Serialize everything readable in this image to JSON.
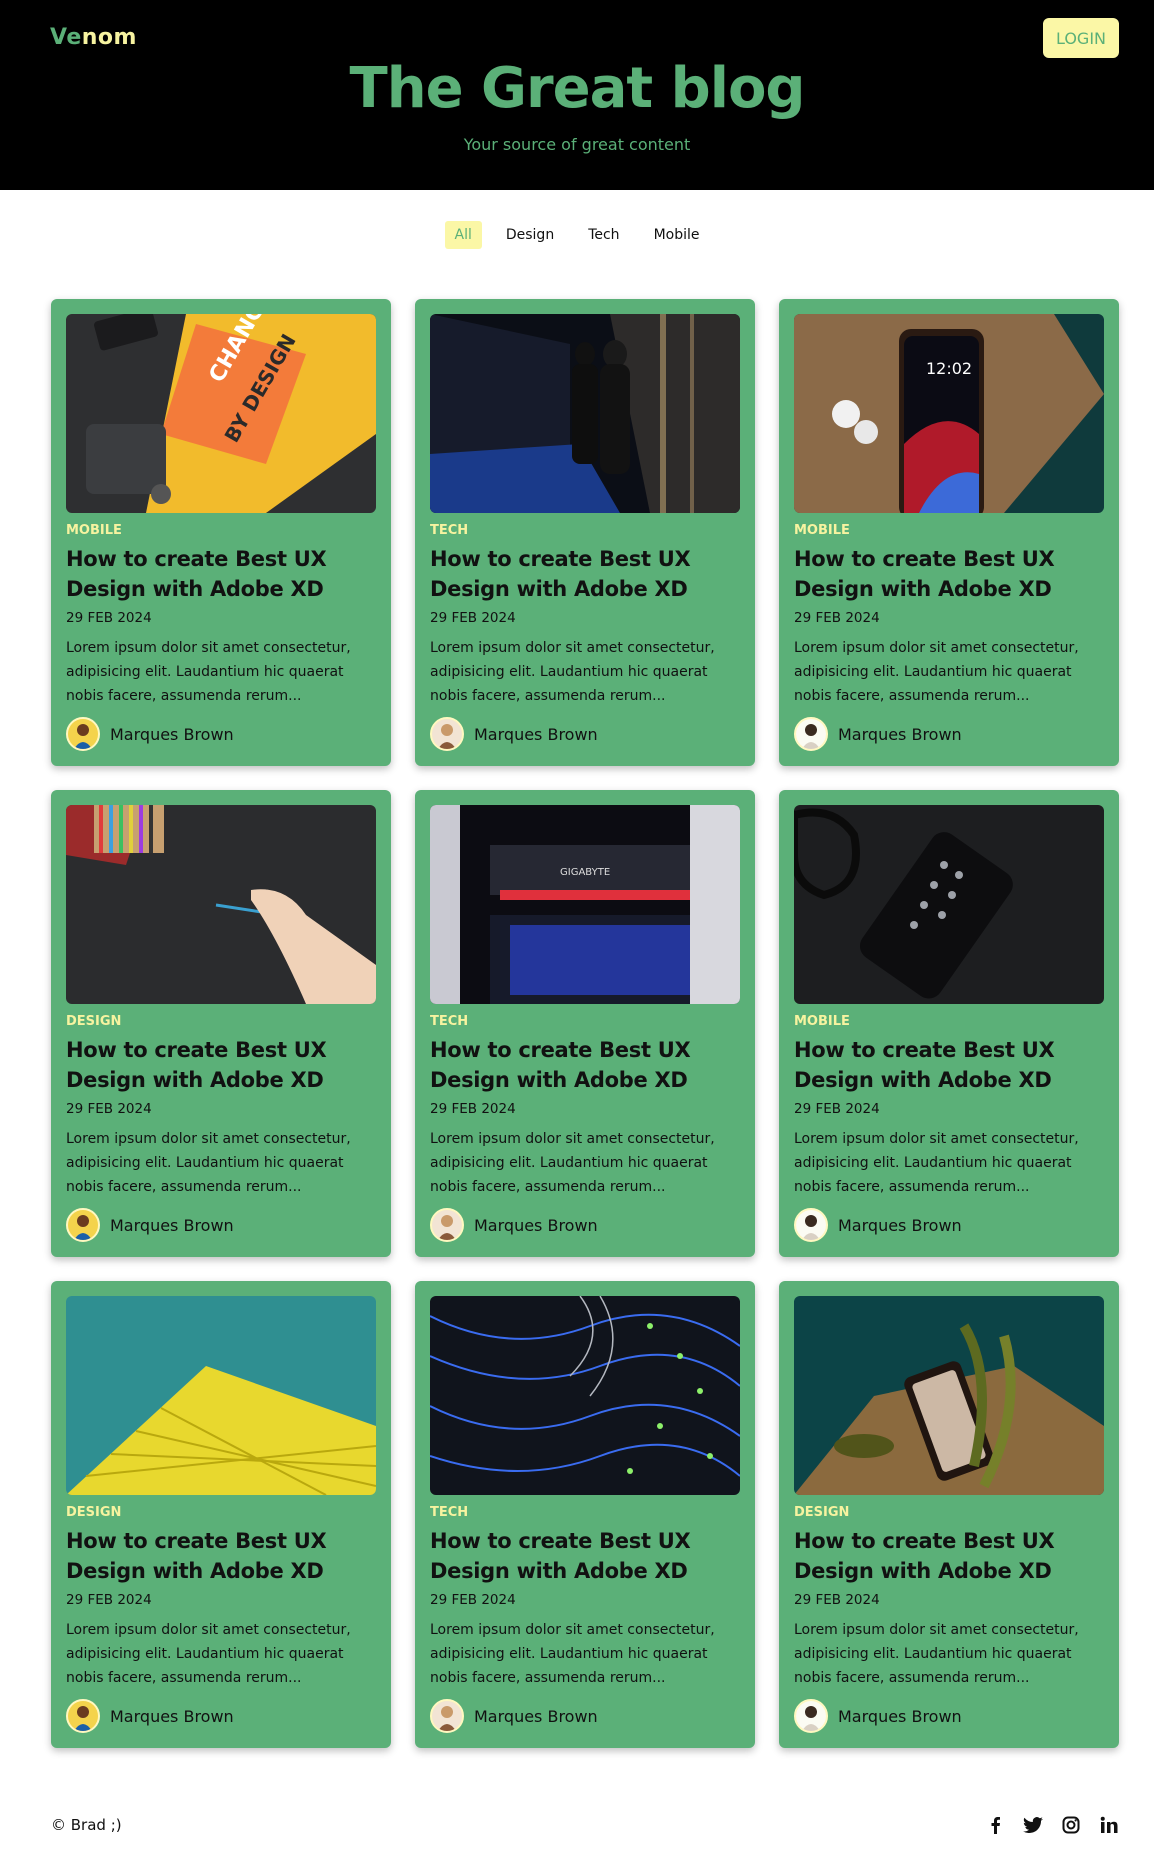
{
  "header": {
    "logo_part1": "Ve",
    "logo_part2": "nom",
    "login_label": "LOGIN",
    "title": "The Great blog",
    "subtitle": "Your source of great content"
  },
  "filters": [
    "All",
    "Design",
    "Tech",
    "Mobile"
  ],
  "active_filter": "All",
  "posts": [
    {
      "tag": "MOBILE",
      "title": "How to create Best UX Design with Adobe XD",
      "date": "29 FEB 2024",
      "excerpt": "Lorem ipsum dolor sit amet consectetur, adipisicing elit. Laudantium hic quaerat nobis facere, assumenda rerum...",
      "author": "Marques Brown",
      "image": "orange-book-desk",
      "avatar": "avatar-a"
    },
    {
      "tag": "TECH",
      "title": "How to create Best UX Design with Adobe XD",
      "date": "29 FEB 2024",
      "excerpt": "Lorem ipsum dolor sit amet consectetur, adipisicing elit. Laudantium hic quaerat nobis facere, assumenda rerum...",
      "author": "Marques Brown",
      "image": "server-room",
      "avatar": "avatar-b"
    },
    {
      "tag": "MOBILE",
      "title": "How to create Best UX Design with Adobe XD",
      "date": "29 FEB 2024",
      "excerpt": "Lorem ipsum dolor sit amet consectetur, adipisicing elit. Laudantium hic quaerat nobis facere, assumenda rerum...",
      "author": "Marques Brown",
      "image": "phone-earbuds",
      "avatar": "avatar-c"
    },
    {
      "tag": "DESIGN",
      "title": "How to create Best UX Design with Adobe XD",
      "date": "29 FEB 2024",
      "excerpt": "Lorem ipsum dolor sit amet consectetur, adipisicing elit. Laudantium hic quaerat nobis facere, assumenda rerum...",
      "author": "Marques Brown",
      "image": "pencils-drawing",
      "avatar": "avatar-a"
    },
    {
      "tag": "TECH",
      "title": "How to create Best UX Design with Adobe XD",
      "date": "29 FEB 2024",
      "excerpt": "Lorem ipsum dolor sit amet consectetur, adipisicing elit. Laudantium hic quaerat nobis facere, assumenda rerum...",
      "author": "Marques Brown",
      "image": "gpu-pc",
      "avatar": "avatar-b"
    },
    {
      "tag": "MOBILE",
      "title": "How to create Best UX Design with Adobe XD",
      "date": "29 FEB 2024",
      "excerpt": "Lorem ipsum dolor sit amet consectetur, adipisicing elit. Laudantium hic quaerat nobis facere, assumenda rerum...",
      "author": "Marques Brown",
      "image": "dark-phone-glasses",
      "avatar": "avatar-c"
    },
    {
      "tag": "DESIGN",
      "title": "How to create Best UX Design with Adobe XD",
      "date": "29 FEB 2024",
      "excerpt": "Lorem ipsum dolor sit amet consectetur, adipisicing elit. Laudantium hic quaerat nobis facere, assumenda rerum...",
      "author": "Marques Brown",
      "image": "yellow-building",
      "avatar": "avatar-a"
    },
    {
      "tag": "TECH",
      "title": "How to create Best UX Design with Adobe XD",
      "date": "29 FEB 2024",
      "excerpt": "Lorem ipsum dolor sit amet consectetur, adipisicing elit. Laudantium hic quaerat nobis facere, assumenda rerum...",
      "author": "Marques Brown",
      "image": "network-cables",
      "avatar": "avatar-b"
    },
    {
      "tag": "DESIGN",
      "title": "How to create Best UX Design with Adobe XD",
      "date": "29 FEB 2024",
      "excerpt": "Lorem ipsum dolor sit amet consectetur, adipisicing elit. Laudantium hic quaerat nobis facere, assumenda rerum...",
      "author": "Marques Brown",
      "image": "phone-plant",
      "avatar": "avatar-c"
    }
  ],
  "footer": {
    "copyright": "© Brad ;)",
    "socials": [
      "facebook-icon",
      "twitter-icon",
      "instagram-icon",
      "linkedin-icon"
    ]
  },
  "colors": {
    "accent_green": "#5bb078",
    "accent_yellow": "#fbf7a6",
    "header_bg": "#000000"
  }
}
